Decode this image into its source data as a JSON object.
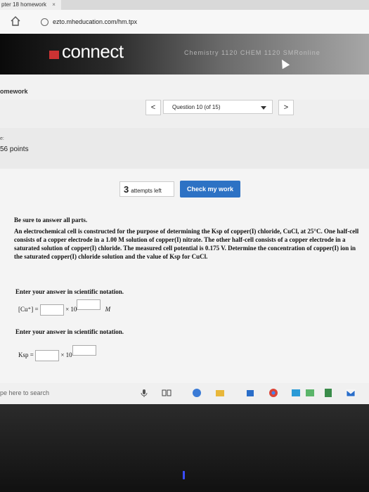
{
  "browser": {
    "tab_title": "pter 18 homework",
    "tab_close": "×",
    "url": "ezto.mheducation.com/hm.tpx"
  },
  "banner": {
    "logo": "connect",
    "course": "Chemistry 1120 CHEM 1120 SMRonline"
  },
  "header": {
    "section": "omework",
    "prev_label": "<",
    "next_label": ">",
    "question_selector": "Question 10 (of 15)",
    "score_prefix": "e:",
    "score": "56 points"
  },
  "actions": {
    "attempts_number": "3",
    "attempts_text": "attempts left",
    "check_label": "Check my work"
  },
  "question": {
    "instruction": "Be sure to answer all parts.",
    "body": "An electrochemical cell is constructed for the purpose of determining the Ksp of copper(I) chloride, CuCl, at 25°C. One half-cell consists of a copper electrode in a 1.00 M solution of copper(I) nitrate. The other half-cell consists of a copper electrode in a saturated solution of copper(I) chloride. The measured cell potential is 0.175 V. Determine the concentration of copper(I) ion in the saturated copper(I) chloride solution and the value of Ksp for CuCl.",
    "sci_note_1": "Enter your answer in scientific notation.",
    "field1_label": "[Cu⁺] =",
    "times_ten": "× 10",
    "field1_unit": "M",
    "sci_note_2": "Enter your answer in scientific notation.",
    "field2_label": "Ksp ="
  },
  "taskbar": {
    "search_placeholder": "pe here to search"
  }
}
